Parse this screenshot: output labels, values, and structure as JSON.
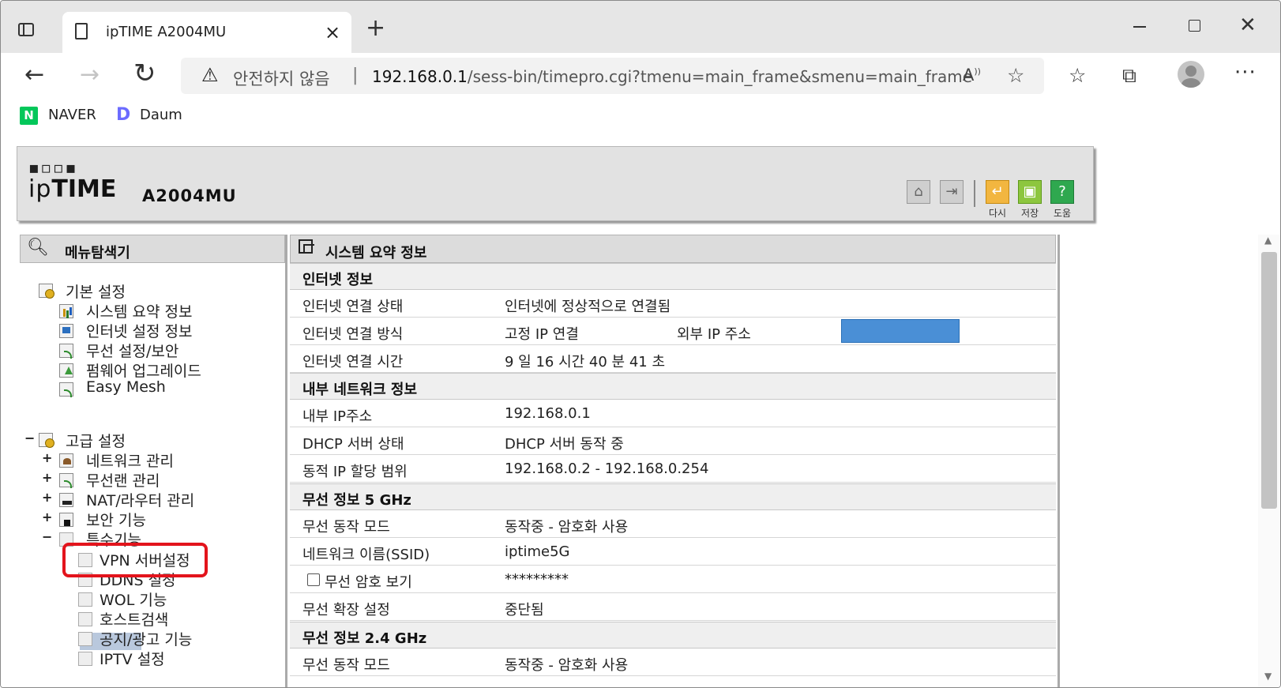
{
  "browser": {
    "tab_title": "ipTIME A2004MU",
    "new_tab": "+",
    "close_tab": "×",
    "security_label": "안전하지 않음",
    "separator": "|",
    "url_host": "192.168.0.1",
    "url_path": "/sess-bin/timepro.cgi?tmenu=main_frame&smenu=main_frame",
    "bookmarks": [
      {
        "label": "NAVER",
        "icon": "N"
      },
      {
        "label": "Daum",
        "icon": "D"
      }
    ]
  },
  "router": {
    "logo_dots": "▪︎▫︎▫︎▪︎",
    "logo_ip": "ip",
    "logo_time": "TIME",
    "model": "A2004MU",
    "toolbar": {
      "reset_label": "다시",
      "save_label": "저장",
      "help_label": "도움"
    },
    "sidebar": {
      "title": "메뉴탐색기",
      "basic": {
        "label": "기본 설정",
        "items": [
          "시스템 요약 정보",
          "인터넷 설정 정보",
          "무선 설정/보안",
          "펌웨어 업그레이드",
          "Easy Mesh"
        ]
      },
      "advanced": {
        "label": "고급 설정",
        "toggle": "−",
        "items": [
          {
            "label": "네트워크 관리",
            "toggle": "+"
          },
          {
            "label": "무선랜 관리",
            "toggle": "+"
          },
          {
            "label": "NAT/라우터 관리",
            "toggle": "+"
          },
          {
            "label": "보안 기능",
            "toggle": "+"
          },
          {
            "label": "특수기능",
            "toggle": "−"
          }
        ]
      },
      "special": [
        "VPN 서버설정",
        "DDNS 설정",
        "WOL 기능",
        "호스트검색",
        "공지/광고 기능",
        "IPTV 설정"
      ]
    },
    "content": {
      "title": "시스템 요약 정보",
      "internet": {
        "header": "인터넷 정보",
        "status_label": "인터넷 연결 상태",
        "status_value": "인터넷에 정상적으로 연결됨",
        "method_label": "인터넷 연결 방식",
        "method_value": "고정 IP 연결",
        "external_ip_label": "외부 IP 주소",
        "uptime_label": "인터넷 연결 시간",
        "uptime_value": "9 일 16 시간 40 분 41 초"
      },
      "lan": {
        "header": "내부 네트워크 정보",
        "ip_label": "내부 IP주소",
        "ip_value": "192.168.0.1",
        "dhcp_label": "DHCP 서버 상태",
        "dhcp_value": "DHCP 서버 동작 중",
        "range_label": "동적 IP 할당 범위",
        "range_value": "192.168.0.2 -  192.168.0.254"
      },
      "wifi5": {
        "header": "무선 정보 5 GHz",
        "mode_label": "무선 동작 모드",
        "mode_value": "동작중 - 암호화 사용",
        "ssid_label": "네트워크 이름(SSID)",
        "ssid_value": "iptime5G",
        "password_label": "무선 암호 보기",
        "password_value": "*********",
        "extend_label": "무선 확장 설정",
        "extend_value": "중단됨"
      },
      "wifi24": {
        "header": "무선 정보 2.4 GHz",
        "mode_label": "무선 동작 모드",
        "mode_value": "동작중 - 암호화 사용"
      }
    }
  },
  "colors": {
    "highlight": "#e3141c",
    "ip_mask": "#4a8fd6"
  }
}
